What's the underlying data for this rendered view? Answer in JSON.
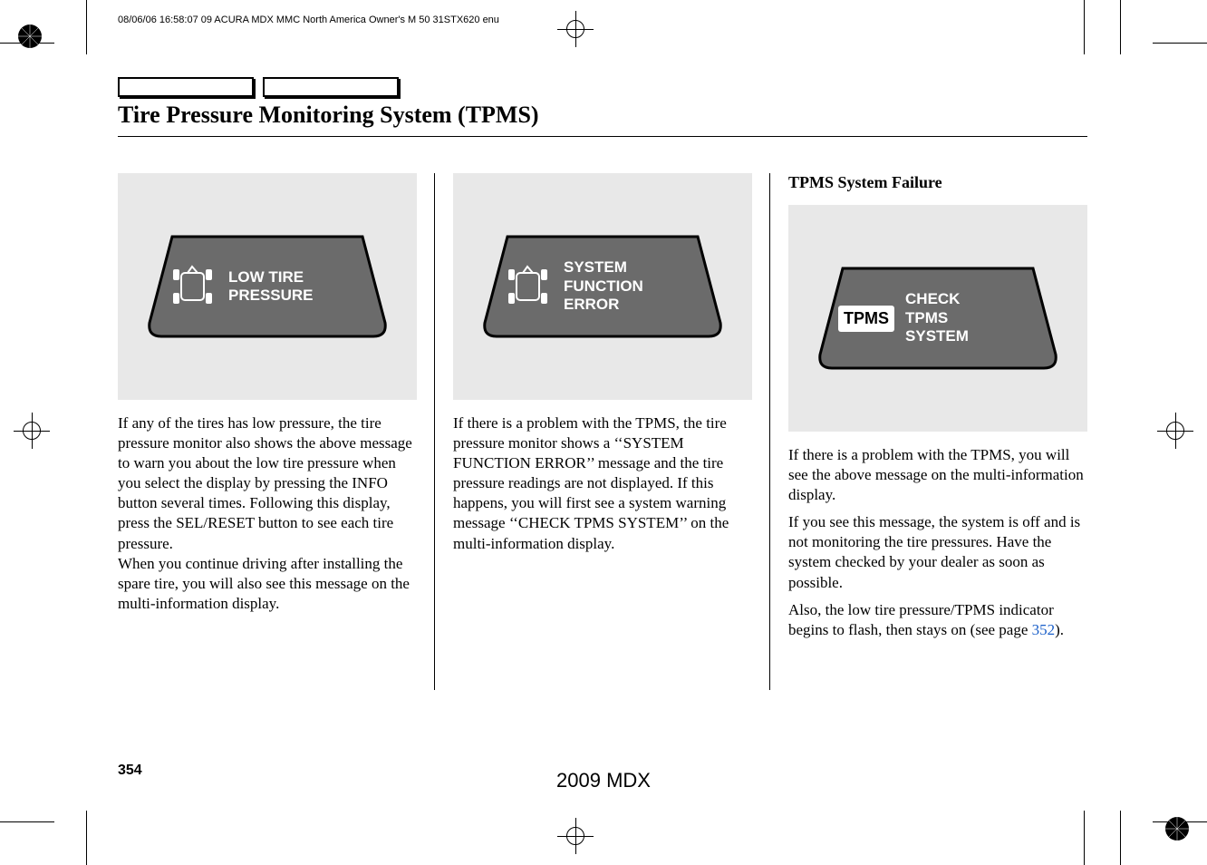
{
  "header": {
    "metadata": "08/06/06 16:58:07   09 ACURA MDX MMC North America Owner's M 50 31STX620 enu"
  },
  "page": {
    "title": "Tire Pressure Monitoring System (TPMS)",
    "number": "354",
    "footer_model": "2009 MDX"
  },
  "col1": {
    "display_text": "LOW TIRE\nPRESSURE",
    "body": "If any of the tires has low pressure, the tire pressure monitor also shows the above message to warn you about the low tire pressure when you select the display by pressing the INFO button several times. Following this display, press the SEL/RESET button to see each tire pressure.",
    "body2": "When you continue driving after installing the spare tire, you will also see this message on the multi-information display."
  },
  "col2": {
    "display_text": "SYSTEM\nFUNCTION\nERROR",
    "body": "If there is a problem with the TPMS, the tire pressure monitor shows a ‘‘SYSTEM FUNCTION ERROR’’ message and the tire pressure readings are not displayed. If this happens, you will first see a system warning message ‘‘CHECK TPMS SYSTEM’’ on the multi-information display."
  },
  "col3": {
    "heading": "TPMS System Failure",
    "badge": "TPMS",
    "display_text": "CHECK\nTPMS\nSYSTEM",
    "body1": "If there is a problem with the TPMS, you will see the above message on the multi-information display.",
    "body2": "If you see this message, the system is off and is not monitoring the tire pressures. Have the system checked by your dealer as soon as possible.",
    "body3_pre": "Also, the low tire pressure/TPMS indicator begins to flash, then stays on (see page ",
    "body3_ref": "352",
    "body3_post": ")."
  }
}
